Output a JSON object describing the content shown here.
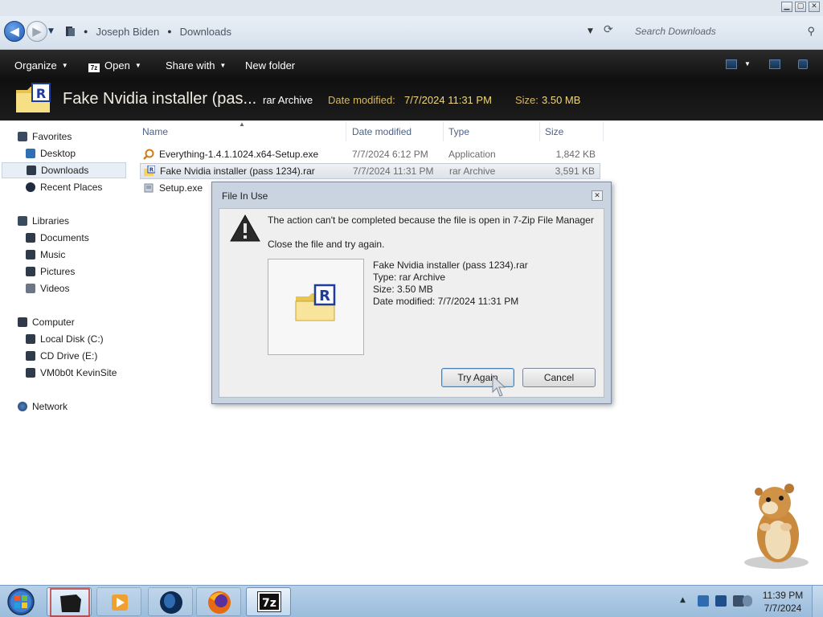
{
  "window": {
    "minimize_glyph": "▁",
    "maximize_glyph": "▢",
    "close_glyph": "✕"
  },
  "address": {
    "back_glyph": "◀",
    "forward_glyph": "▶",
    "crumbs": [
      "Joseph Biden",
      "Downloads"
    ],
    "search_placeholder": "Search Downloads"
  },
  "toolbar": {
    "organize": "Organize",
    "open": "Open",
    "share_with": "Share with",
    "new_folder": "New folder"
  },
  "details": {
    "name": "Fake Nvidia installer (pas...",
    "type": "rar Archive",
    "date_label": "Date modified:",
    "date_value": "7/7/2024 11:31 PM",
    "size_label": "Size:",
    "size_value": "3.50 MB"
  },
  "nav": {
    "favorites": "Favorites",
    "desktop": "Desktop",
    "downloads": "Downloads",
    "recent_places": "Recent Places",
    "libraries": "Libraries",
    "documents": "Documents",
    "music": "Music",
    "pictures": "Pictures",
    "videos": "Videos",
    "computer": "Computer",
    "local_disk": "Local Disk (C:)",
    "cd_drive": "CD Drive (E:)",
    "network_share": "VM0b0t KevinSite",
    "network": "Network"
  },
  "columns": {
    "name": "Name",
    "date_modified": "Date modified",
    "type": "Type",
    "size": "Size"
  },
  "files": [
    {
      "name": "Everything-1.4.1.1024.x64-Setup.exe",
      "date": "7/7/2024 6:12 PM",
      "type": "Application",
      "size": "1,842 KB"
    },
    {
      "name": "Fake Nvidia installer (pass 1234).rar",
      "date": "7/7/2024 11:31 PM",
      "type": "rar Archive",
      "size": "3,591 KB"
    },
    {
      "name": "Setup.exe",
      "date": "",
      "type": "",
      "size": ""
    }
  ],
  "dialog": {
    "title": "File In Use",
    "message": "The action can't be completed because the file is open in 7-Zip File Manager",
    "hint": "Close the file and try again.",
    "file_name": "Fake Nvidia installer (pass 1234).rar",
    "file_type": "Type: rar Archive",
    "file_size": "Size: 3.50 MB",
    "file_date": "Date modified: 7/7/2024 11:31 PM",
    "try_again": "Try Again",
    "cancel": "Cancel"
  },
  "taskbar": {
    "zip_label": "7z"
  },
  "clock": {
    "time": "11:39 PM",
    "date": "7/7/2024"
  },
  "colors": {
    "accent": "#1d56b1",
    "toolbar_bg": "#1a1a1a",
    "detail_label": "#d4b96a",
    "taskbar_bg": "#a8c6e2"
  }
}
